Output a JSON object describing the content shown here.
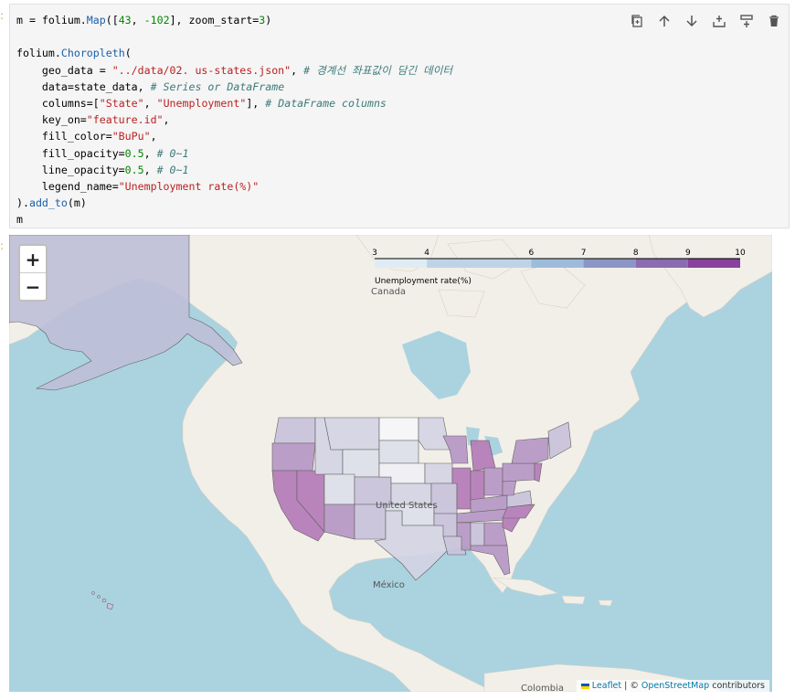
{
  "prompt_marker": ":",
  "code_lines": [
    {
      "parts": [
        [
          "m = folium.",
          ""
        ],
        [
          "Map",
          "fn"
        ],
        [
          "([",
          ""
        ],
        [
          "43",
          "num"
        ],
        [
          ", ",
          ""
        ],
        [
          "-102",
          "num"
        ],
        [
          "], zoom_start=",
          ""
        ],
        [
          "3",
          "num"
        ],
        [
          ")",
          ""
        ]
      ]
    },
    {
      "parts": []
    },
    {
      "parts": [
        [
          "folium.",
          ""
        ],
        [
          "Choropleth",
          "fn"
        ],
        [
          "(",
          ""
        ]
      ]
    },
    {
      "parts": [
        [
          "    geo_data = ",
          ""
        ],
        [
          "\"../data/02. us-states.json\"",
          "str"
        ],
        [
          ", ",
          ""
        ],
        [
          "# 경계선 좌표값이 담긴 데이터",
          "cm"
        ]
      ]
    },
    {
      "parts": [
        [
          "    data=state_data, ",
          ""
        ],
        [
          "# Series or DataFrame",
          "cm"
        ]
      ]
    },
    {
      "parts": [
        [
          "    columns=[",
          ""
        ],
        [
          "\"State\"",
          "str"
        ],
        [
          ", ",
          ""
        ],
        [
          "\"Unemployment\"",
          "str"
        ],
        [
          "], ",
          ""
        ],
        [
          "# DataFrame columns",
          "cm"
        ]
      ]
    },
    {
      "parts": [
        [
          "    key_on=",
          ""
        ],
        [
          "\"feature.id\"",
          "str"
        ],
        [
          ",",
          ""
        ]
      ]
    },
    {
      "parts": [
        [
          "    fill_color=",
          ""
        ],
        [
          "\"BuPu\"",
          "str"
        ],
        [
          ",",
          ""
        ]
      ]
    },
    {
      "parts": [
        [
          "    fill_opacity=",
          ""
        ],
        [
          "0.5",
          "num"
        ],
        [
          ", ",
          ""
        ],
        [
          "# 0~1",
          "cm"
        ]
      ]
    },
    {
      "parts": [
        [
          "    line_opacity=",
          ""
        ],
        [
          "0.5",
          "num"
        ],
        [
          ", ",
          ""
        ],
        [
          "# 0~1",
          "cm"
        ]
      ]
    },
    {
      "parts": [
        [
          "    legend_name=",
          ""
        ],
        [
          "\"Unemployment rate(%)\"",
          "str"
        ]
      ]
    },
    {
      "parts": [
        [
          ").",
          ""
        ],
        [
          "add_to",
          "fn"
        ],
        [
          "(m)",
          ""
        ]
      ]
    },
    {
      "parts": [
        [
          "m",
          ""
        ]
      ]
    }
  ],
  "toolbar": [
    {
      "name": "duplicate-cell-icon",
      "title": "Duplicate"
    },
    {
      "name": "move-up-icon",
      "title": "Move up"
    },
    {
      "name": "move-down-icon",
      "title": "Move down"
    },
    {
      "name": "insert-above-icon",
      "title": "Insert above"
    },
    {
      "name": "insert-below-icon",
      "title": "Insert below"
    },
    {
      "name": "delete-icon",
      "title": "Delete"
    }
  ],
  "map": {
    "zoom_in": "+",
    "zoom_out": "−",
    "labels": {
      "canada": "Canada",
      "usa": "United States",
      "mexico": "México",
      "colombia": "Colombia"
    },
    "legend": {
      "title": "Unemployment rate(%)",
      "ticks": [
        "3",
        "4",
        "6",
        "7",
        "8",
        "9",
        "10"
      ],
      "colors": [
        "#f7fcfd",
        "#e0ecf4",
        "#bfd3e6",
        "#9ebcda",
        "#8c96c6",
        "#8c6bb1",
        "#88419d"
      ]
    },
    "attribution": {
      "leaflet": "Leaflet",
      "sep": " | © ",
      "osm": "OpenStreetMap",
      "rest": " contributors"
    }
  },
  "colors": {
    "water": "#aad3df",
    "land": "#f2efe9",
    "code_bg": "#f5f5f5"
  }
}
